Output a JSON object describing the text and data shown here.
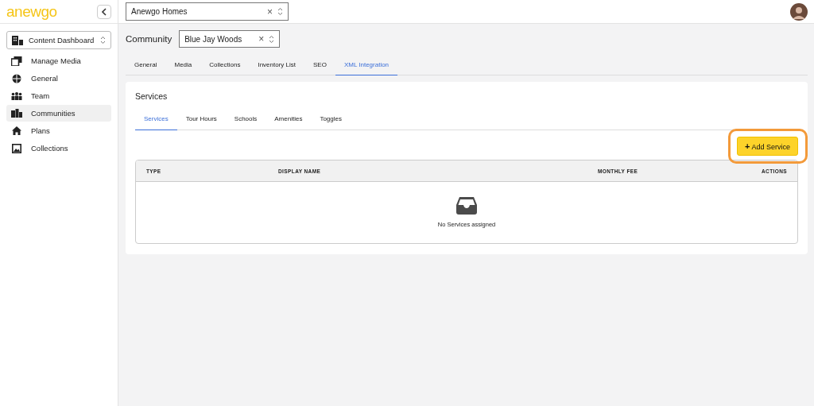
{
  "logo": "anewgo",
  "company_select": {
    "value": "Anewgo Homes",
    "clear": "×"
  },
  "sidebar": {
    "dashboard_select": {
      "value": "Content Dashboard"
    },
    "items": [
      {
        "label": "Manage Media",
        "kind": "media",
        "selected": false
      },
      {
        "label": "General",
        "kind": "globe",
        "selected": false
      },
      {
        "label": "Team",
        "kind": "team",
        "selected": false
      },
      {
        "label": "Communities",
        "kind": "communities",
        "selected": true
      },
      {
        "label": "Plans",
        "kind": "home",
        "selected": false
      },
      {
        "label": "Collections",
        "kind": "collections",
        "selected": false
      }
    ]
  },
  "community": {
    "label": "Community",
    "value": "Blue Jay Woods",
    "clear": "×"
  },
  "tabs": [
    {
      "label": "General",
      "selected": false
    },
    {
      "label": "Media",
      "selected": false
    },
    {
      "label": "Collections",
      "selected": false
    },
    {
      "label": "Inventory List",
      "selected": false
    },
    {
      "label": "SEO",
      "selected": false
    },
    {
      "label": "XML Integration",
      "selected": true
    }
  ],
  "card": {
    "title": "Services",
    "subtabs": [
      {
        "label": "Services",
        "selected": true
      },
      {
        "label": "Tour Hours",
        "selected": false
      },
      {
        "label": "Schools",
        "selected": false
      },
      {
        "label": "Amenities",
        "selected": false
      },
      {
        "label": "Toggles",
        "selected": false
      }
    ],
    "add_button": {
      "icon": "+",
      "label": "Add Service",
      "highlighted": true
    },
    "table": {
      "columns": [
        "TYPE",
        "DISPLAY NAME",
        "MONTHLY FEE",
        "ACTIONS"
      ],
      "empty_text": "No Services assigned"
    }
  }
}
